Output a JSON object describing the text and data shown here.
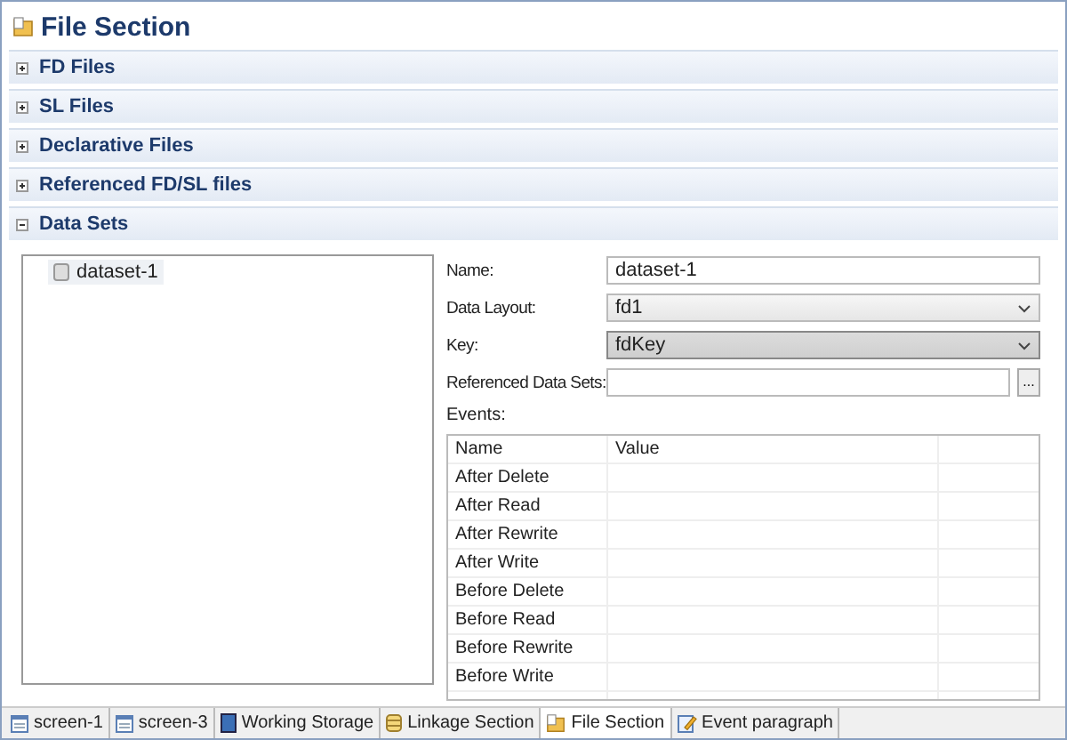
{
  "title": "File Section",
  "sections": [
    {
      "label": "FD Files",
      "expanded": false
    },
    {
      "label": "SL Files",
      "expanded": false
    },
    {
      "label": "Declarative Files",
      "expanded": false
    },
    {
      "label": "Referenced FD/SL files",
      "expanded": false
    },
    {
      "label": "Data Sets",
      "expanded": true
    }
  ],
  "tree": [
    {
      "label": "dataset-1",
      "selected": true
    }
  ],
  "form": [
    {
      "kind": "text",
      "label": "Name:",
      "value": "dataset-1"
    },
    {
      "kind": "select",
      "label": "Data Layout:",
      "value": "fd1",
      "hover": false
    },
    {
      "kind": "select",
      "label": "Key:",
      "value": "fdKey",
      "hover": true
    },
    {
      "kind": "browse",
      "label": "Referenced Data Sets:",
      "button": "..."
    }
  ],
  "events": {
    "label": "Events:",
    "columns": [
      "Name",
      "Value"
    ],
    "rows": [
      "After Delete",
      "After Read",
      "After Rewrite",
      "After Write",
      "Before Delete",
      "Before Read",
      "Before Rewrite",
      "Before Write"
    ]
  },
  "tabs": [
    {
      "label": "screen-1",
      "kind": "screen",
      "selected": false
    },
    {
      "label": "screen-3",
      "kind": "screen",
      "selected": false
    },
    {
      "label": "Working Storage",
      "kind": "storage",
      "selected": false
    },
    {
      "label": "Linkage Section",
      "kind": "linkage",
      "selected": false
    },
    {
      "label": "File Section",
      "kind": "file",
      "selected": true
    },
    {
      "label": "Event paragraph",
      "kind": "event",
      "selected": false
    }
  ]
}
